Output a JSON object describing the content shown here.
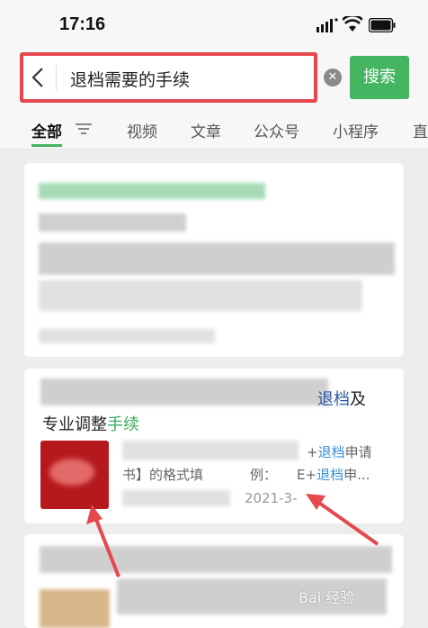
{
  "status_bar": {
    "time": "17:16"
  },
  "search": {
    "query": "退档需要的手续",
    "button_label": "搜索",
    "clear_glyph": "✕"
  },
  "tabs": [
    {
      "label": "全部",
      "active": true
    },
    {
      "label": "视频"
    },
    {
      "label": "文章"
    },
    {
      "label": "公众号"
    },
    {
      "label": "小程序"
    },
    {
      "label": "直"
    }
  ],
  "result_2": {
    "title_highlight_1": "退档",
    "title_after_1": "及",
    "title_line2_prefix": "专业调整",
    "title_highlight_2": "手续",
    "snippet_line1_suffix": "+",
    "snippet_line1_highlight": "退档",
    "snippet_line1_tail": "申请",
    "snippet_line2_prefix": "书】的格式填",
    "snippet_line2_mid": "例：",
    "snippet_line2_suffix": "E+",
    "snippet_line2_highlight": "退档",
    "snippet_line2_tail": "申...",
    "date": "2021-3-"
  },
  "watermark": {
    "text": "Bai 经验"
  },
  "colors": {
    "accent_green": "#45b562",
    "highlight_red": "#e5484d",
    "link_blue": "#2b5aa5",
    "thumbnail_red": "#b5191c"
  }
}
